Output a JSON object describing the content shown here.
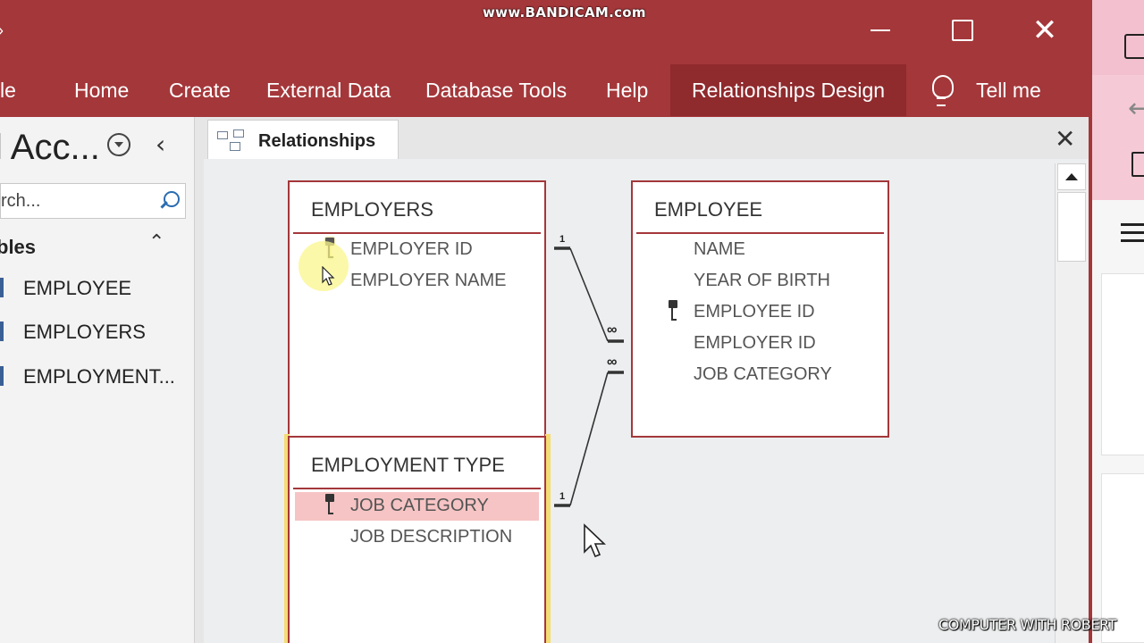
{
  "recording_watermark": "www.BANDICAM.com",
  "corner_watermark": "COMPUTER WITH ROBERT",
  "ribbon": {
    "tabs": [
      {
        "label": "le"
      },
      {
        "label": "Home"
      },
      {
        "label": "Create"
      },
      {
        "label": "External Data"
      },
      {
        "label": "Database Tools"
      },
      {
        "label": "Help"
      },
      {
        "label": "Relationships Design",
        "active": true
      }
    ],
    "tell_me": "Tell me"
  },
  "nav_pane": {
    "title": "l Acc...",
    "search_placeholder": "rch...",
    "group_title": "bles",
    "items": [
      {
        "label": "EMPLOYEE"
      },
      {
        "label": "EMPLOYERS"
      },
      {
        "label": "EMPLOYMENT..."
      }
    ]
  },
  "document": {
    "tab_label": "Relationships"
  },
  "tables": {
    "employers": {
      "title": "EMPLOYERS",
      "fields": [
        {
          "name": "EMPLOYER ID",
          "key": true
        },
        {
          "name": "EMPLOYER NAME",
          "key": false
        }
      ]
    },
    "employee": {
      "title": "EMPLOYEE",
      "fields": [
        {
          "name": "NAME",
          "key": false
        },
        {
          "name": "YEAR OF BIRTH",
          "key": false
        },
        {
          "name": "EMPLOYEE ID",
          "key": true
        },
        {
          "name": "EMPLOYER ID",
          "key": false
        },
        {
          "name": "JOB CATEGORY",
          "key": false
        }
      ]
    },
    "employment_type": {
      "title": "EMPLOYMENT TYPE",
      "fields": [
        {
          "name": "JOB CATEGORY",
          "key": true,
          "selected": true
        },
        {
          "name": "JOB DESCRIPTION",
          "key": false
        }
      ]
    }
  },
  "relationships": [
    {
      "one_label": "1",
      "many_label": "∞"
    },
    {
      "one_label": "1",
      "many_label": "∞"
    }
  ],
  "colors": {
    "accent": "#a4373a",
    "selected_field": "#f6c4c4"
  }
}
